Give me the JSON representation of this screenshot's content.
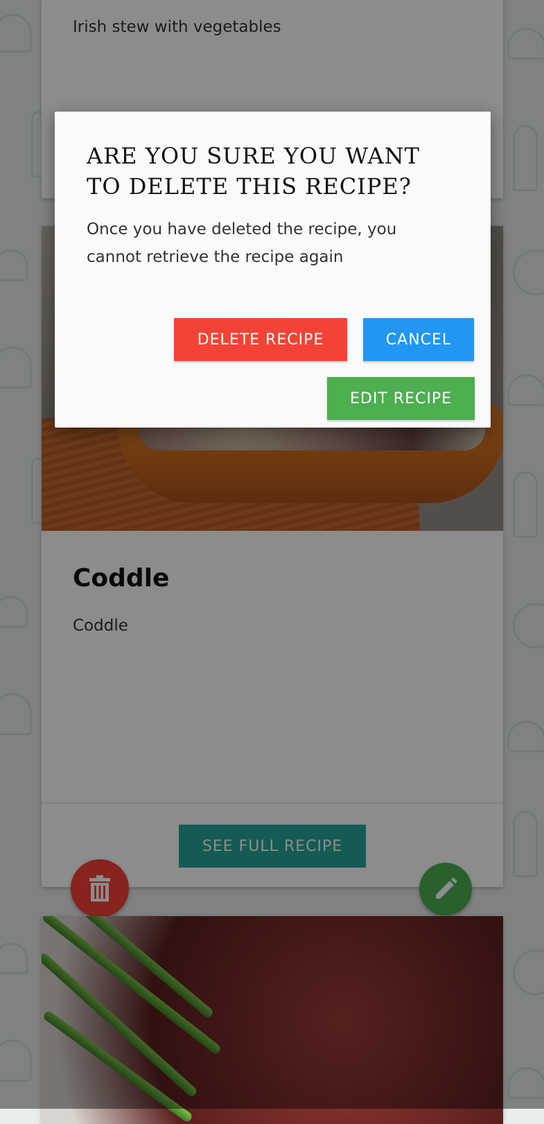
{
  "cards": {
    "top": {
      "description": "Irish stew with vegetables"
    },
    "middle": {
      "title": "Coddle",
      "description": "Coddle",
      "see_full_label": "SEE FULL RECIPE"
    }
  },
  "fab": {
    "delete_icon": "trash-icon",
    "edit_icon": "pencil-icon"
  },
  "modal": {
    "title": "ARE YOU SURE YOU WANT TO DELETE THIS RECIPE?",
    "text": "Once you have deleted the recipe, you cannot retrieve the recipe again",
    "delete_label": "DELETE RECIPE",
    "cancel_label": "CANCEL",
    "edit_label": "EDIT RECIPE"
  },
  "colors": {
    "danger": "#f44336",
    "primary": "#2196f3",
    "success": "#4caf50",
    "teal": "#26a69a"
  }
}
